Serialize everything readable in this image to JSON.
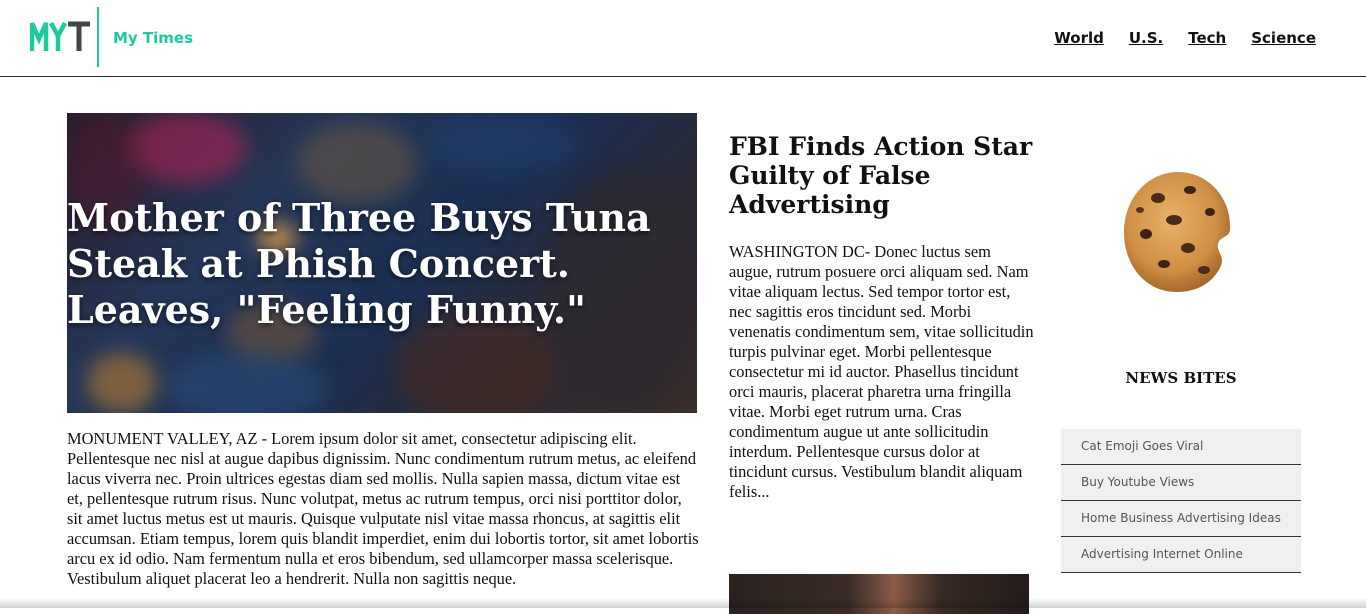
{
  "header": {
    "logo_text": "MYT",
    "brand": "My Times",
    "nav": [
      "World",
      "U.S.",
      "Tech",
      "Science"
    ]
  },
  "colors": {
    "accent": "#1ec9a0",
    "logo_dark": "#444444"
  },
  "lead_story": {
    "title": "Mother of Three Buys Tuna Steak at Phish Concert. Leaves, \"Feeling Funny.\"",
    "body": "MONUMENT VALLEY, AZ - Lorem ipsum dolor sit amet, consectetur adipiscing elit. Pellentesque nec nisl at augue dapibus dignissim. Nunc condimentum rutrum metus, ac eleifend lacus viverra nec. Proin ultrices egestas diam sed mollis. Nulla sapien massa, dictum vitae est et, pellentesque rutrum risus. Nunc volutpat, metus ac rutrum tempus, orci nisi porttitor dolor, sit amet luctus metus est ut mauris. Quisque vulputate nisl vitae massa rhoncus, at sagittis elit accumsan. Etiam tempus, lorem quis blandit imperdiet, enim dui lobortis tortor, sit amet lobortis arcu ex id odio. Nam fermentum nulla et eros bibendum, sed ullamcorper massa scelerisque. Vestibulum aliquet placerat leo a hendrerit. Nulla non sagittis neque."
  },
  "second_story": {
    "title": "FBI Finds Action Star Guilty of False Advertising",
    "body": "WASHINGTON DC- Donec luctus sem augue, rutrum posuere orci aliquam sed. Nam vitae aliquam lectus. Sed tempor tortor est, nec sagittis eros tincidunt sed. Morbi venenatis condimentum sem, vitae sollicitudin turpis pulvinar eget. Morbi pellentesque consectetur mi id auctor. Phasellus tincidunt orci mauris, placerat pharetra urna fringilla vitae. Morbi eget rutrum urna. Cras condimentum augue ut ante sollicitudin interdum. Pellentesque cursus dolor at tincidunt cursus. Vestibulum blandit aliquam felis..."
  },
  "news_bites": {
    "heading": "NEWS BITES",
    "items": [
      "Cat Emoji Goes Viral",
      "Buy Youtube Views",
      "Home Business Advertising Ideas",
      "Advertising Internet Online"
    ]
  }
}
